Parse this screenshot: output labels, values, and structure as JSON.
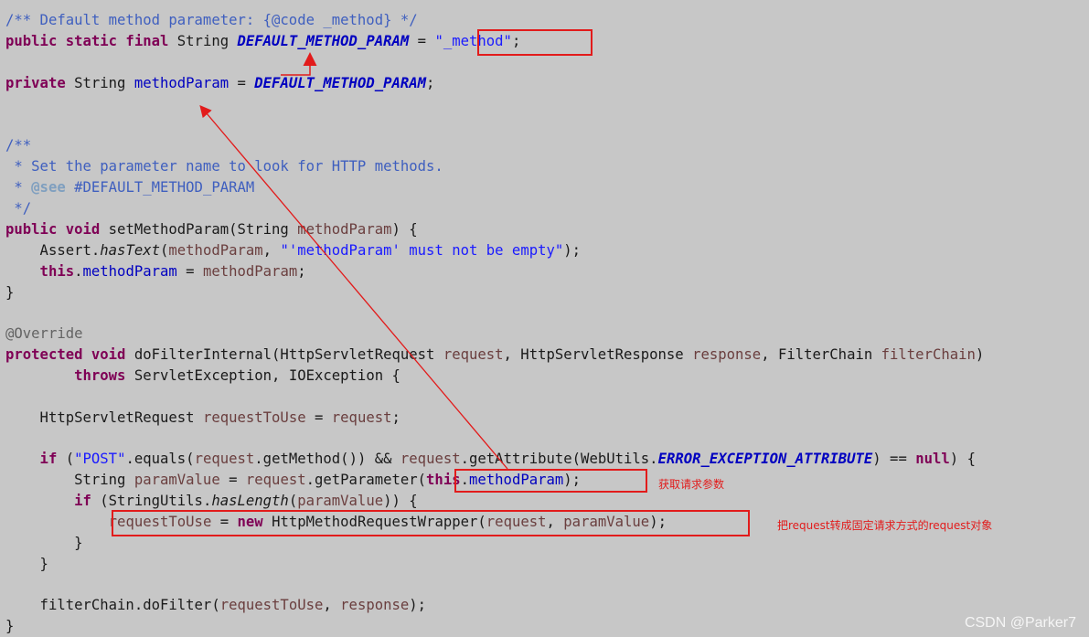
{
  "code": {
    "l1": "/** Default method parameter: {@code _method} */",
    "l2": {
      "kw": "public static final",
      "type": " String ",
      "name": "DEFAULT_METHOD_PARAM",
      "op": " = ",
      "val": "\"_method\"",
      "end": ";"
    },
    "l3": {
      "kw": "private",
      "type": " String ",
      "name": "methodParam",
      "op": " = ",
      "val": "DEFAULT_METHOD_PARAM",
      "end": ";"
    },
    "l4": "/**",
    "l5": " * Set the parameter name to look for HTTP methods.",
    "l6": {
      "star": " * ",
      "tag": "@see",
      "ref": " #DEFAULT_METHOD_PARAM"
    },
    "l7": " */",
    "l8": {
      "kw": "public void",
      "name": " setMethodParam(String ",
      "param": "methodParam",
      "end": ") {"
    },
    "l9": {
      "cls": "    Assert.",
      "call": "hasText",
      "p1": "(",
      "param": "methodParam",
      "p2": ", ",
      "str": "\"'methodParam' must not be empty\"",
      "end": ");"
    },
    "l10": {
      "kw": "    this",
      "dot": ".",
      "field": "methodParam",
      "op": " = ",
      "param": "methodParam",
      "end": ";"
    },
    "l11": "}",
    "l12": "@Override",
    "l13": {
      "kw": "protected void",
      "sig": " doFilterInternal(HttpServletRequest ",
      "p1": "request",
      "s2": ", HttpServletResponse ",
      "p2": "response",
      "s3": ", FilterChain ",
      "p3": "filterChain",
      "end": ")"
    },
    "l14": {
      "indent": "        ",
      "kw": "throws",
      "rest": " ServletException, IOException {"
    },
    "l15": {
      "type": "    HttpServletRequest ",
      "var": "requestToUse",
      "op": " = ",
      "param": "request",
      "end": ";"
    },
    "l16": {
      "kw": "    if",
      "p0": " (",
      "str": "\"POST\"",
      "m1": ".equals(",
      "p1": "request",
      "m2": ".getMethod()) && ",
      "p2": "request",
      "m3": ".getAttribute(WebUtils.",
      "sf": "ERROR_EXCEPTION_ATTRIBUTE",
      "m4": ") == ",
      "kw2": "null",
      "end": ") {"
    },
    "l17": {
      "type": "        String ",
      "var": "paramValue",
      "op": " = ",
      "param": "request",
      "m1": ".getParameter(",
      "kw": "this",
      "dot": ".",
      "field": "methodParam",
      "end": ");"
    },
    "l18": {
      "kw": "        if",
      "m0": " (StringUtils.",
      "call": "hasLength",
      "p0": "(",
      "var": "paramValue",
      "end": ")) {"
    },
    "l19": {
      "indent": "            ",
      "var": "requestToUse",
      "op": " = ",
      "kw": "new",
      "m1": " HttpMethodRequestWrapper(",
      "p1": "request",
      "s": ", ",
      "p2": "paramValue",
      "end": ");"
    },
    "l20": "        }",
    "l21": "    }",
    "l22": {
      "m0": "    filterChain",
      "m1": ".doFilter(",
      "var": "requestToUse",
      "s": ", ",
      "p": "response",
      "end": ");"
    },
    "l23": "}"
  },
  "annotations": {
    "note1": "获取请求参数",
    "note2": "把request转成固定请求方式的request对象"
  },
  "colors": {
    "highlight": "#e21b1b",
    "background": "#c7c7c7"
  },
  "watermark": "CSDN @Parker7"
}
